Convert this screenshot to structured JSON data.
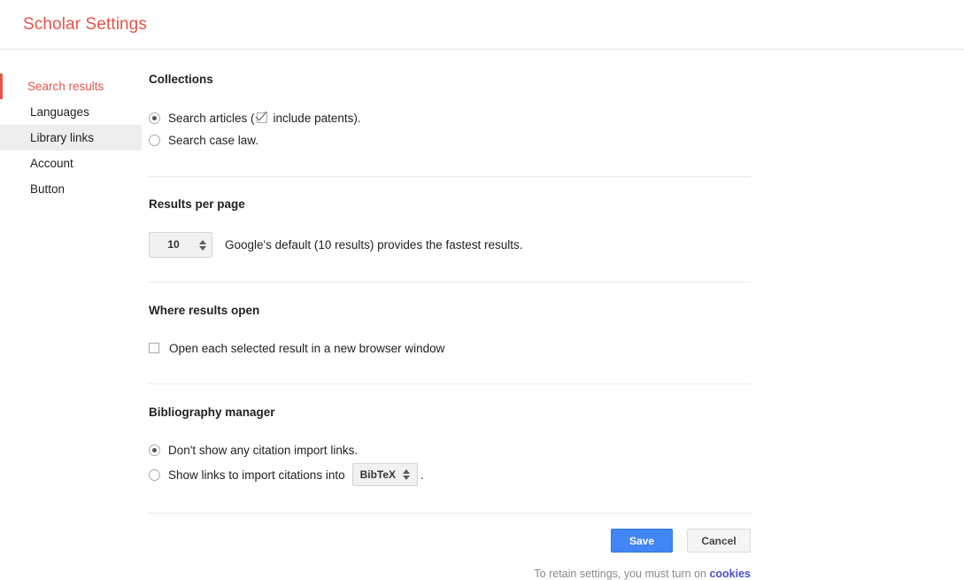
{
  "header": {
    "title": "Scholar Settings"
  },
  "sidebar": {
    "items": [
      {
        "label": "Search results",
        "state": "active"
      },
      {
        "label": "Languages",
        "state": "normal"
      },
      {
        "label": "Library links",
        "state": "hovered"
      },
      {
        "label": "Account",
        "state": "normal"
      },
      {
        "label": "Button",
        "state": "normal"
      }
    ]
  },
  "sections": {
    "collections": {
      "title": "Collections",
      "option_articles_prefix": "Search articles (",
      "option_articles_checkbox_label": "include patents).",
      "option_case_law": "Search case law.",
      "articles_selected": true,
      "include_patents_checked": true,
      "case_law_selected": false
    },
    "results_per_page": {
      "title": "Results per page",
      "value": "10",
      "hint": "Google's default (10 results) provides the fastest results."
    },
    "where_results_open": {
      "title": "Where results open",
      "option_label": "Open each selected result in a new browser window",
      "checked": false
    },
    "bibliography_manager": {
      "title": "Bibliography manager",
      "option_none": "Don't show any citation import links.",
      "option_show_prefix": "Show links to import citations into",
      "option_show_suffix": ".",
      "manager_value": "BibTeX",
      "none_selected": true,
      "show_selected": false
    }
  },
  "actions": {
    "save_label": "Save",
    "cancel_label": "Cancel"
  },
  "footer": {
    "note_prefix": "To retain settings, you must turn on",
    "link_label": "cookies"
  },
  "colors": {
    "accent_red": "#e8544a",
    "save_blue": "#4285f4",
    "link_blue": "#4a53c4"
  }
}
